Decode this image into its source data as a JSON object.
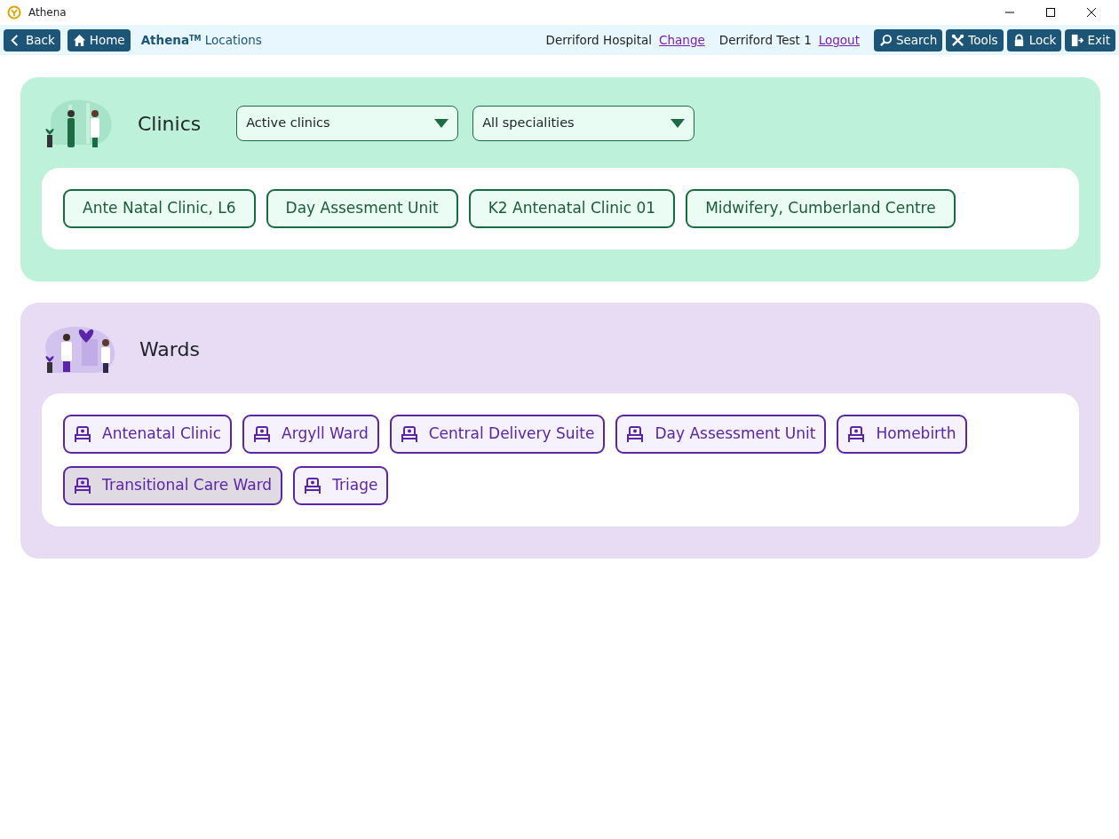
{
  "window": {
    "title": "Athena"
  },
  "toolbar": {
    "nav_buttons": [
      {
        "kind": "back",
        "label": "Back"
      },
      {
        "kind": "home",
        "label": "Home"
      }
    ],
    "brand": "Athena",
    "brand_mark": "TM",
    "page": "Locations",
    "hospital": "Derriford Hospital",
    "change_link": "Change",
    "user": "Derriford Test 1",
    "logout_link": "Logout",
    "actions": [
      {
        "kind": "search",
        "label": "Search"
      },
      {
        "kind": "tools",
        "label": "Tools"
      },
      {
        "kind": "lock",
        "label": "Lock"
      },
      {
        "kind": "exit",
        "label": "Exit"
      }
    ]
  },
  "clinics": {
    "title": "Clinics",
    "filters": [
      {
        "value": "Active clinics"
      },
      {
        "value": "All specialities"
      }
    ],
    "items": [
      {
        "label": "Ante Natal Clinic, L6"
      },
      {
        "label": "Day Assesment Unit"
      },
      {
        "label": "K2 Antenatal Clinic 01"
      },
      {
        "label": "Midwifery, Cumberland Centre"
      }
    ]
  },
  "wards": {
    "title": "Wards",
    "items": [
      {
        "label": "Antenatal Clinic",
        "selected": false
      },
      {
        "label": "Argyll Ward",
        "selected": false
      },
      {
        "label": "Central Delivery Suite",
        "selected": false
      },
      {
        "label": "Day Assessment Unit",
        "selected": false
      },
      {
        "label": "Homebirth",
        "selected": false
      },
      {
        "label": "Transitional Care Ward",
        "selected": true
      },
      {
        "label": "Triage",
        "selected": false
      }
    ]
  }
}
